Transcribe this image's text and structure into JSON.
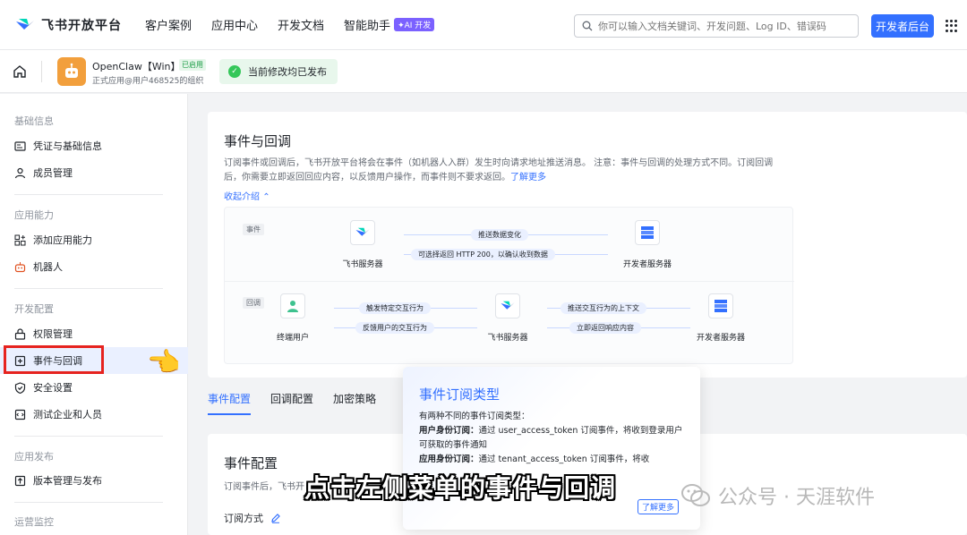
{
  "nav": {
    "brand": "飞书开放平台",
    "links": [
      "客户案例",
      "应用中心",
      "开发文档",
      "智能助手"
    ],
    "ai_badge": "✦AI 开发",
    "search_placeholder": "你可以输入文档关键词、开发问题、Log ID、错误码",
    "dev_console": "开发者后台"
  },
  "appbar": {
    "app_name": "OpenClaw【Win】",
    "online_tag": "已启用",
    "app_sub": "正式应用@用户468525的组织",
    "status": "当前修改均已发布"
  },
  "sidebar": {
    "groups": [
      "基础信息",
      "应用能力",
      "开发配置",
      "应用发布",
      "运营监控"
    ],
    "items": [
      "凭证与基础信息",
      "成员管理",
      "添加应用能力",
      "机器人",
      "权限管理",
      "事件与回调",
      "安全设置",
      "测试企业和人员",
      "版本管理与发布"
    ]
  },
  "card": {
    "title": "事件与回调",
    "desc": "订阅事件或回调后，飞书开放平台将会在事件（如机器人入群）发生时向请求地址推送消息。 注意：事件与回调的处理方式不同。订阅回调后，你需要立即返回回应内容，以反馈用户操作，而事件则不要求返回。",
    "desc_link": "了解更多",
    "collapse": "收起介绍"
  },
  "diagram": {
    "event_tag": "事件",
    "callback_tag": "回调",
    "feishu_server": "飞书服务器",
    "dev_server": "开发者服务器",
    "end_user": "终端用户",
    "push_change": "推送数据变化",
    "optional_return": "可选择返回 HTTP 200，以确认收到数据",
    "trigger": "触发特定交互行为",
    "feedback": "反馈用户的交互行为",
    "push_context": "推送交互行为的上下文",
    "return_now": "立即返回响应内容"
  },
  "tabs": [
    "事件配置",
    "回调配置",
    "加密策略"
  ],
  "event_config": {
    "title": "事件配置",
    "desc": "订阅事件后，飞书开",
    "mode": "订阅方式"
  },
  "popup": {
    "title": "事件订阅类型",
    "intro": "有两种不同的事件订阅类型：",
    "user_label": "用户身份订阅：",
    "user_text": "通过 user_access_token 订阅事件，将收到登录用户可获取的事件通知",
    "app_label": "应用身份订阅：",
    "app_text": "通过 tenant_access_token 订阅事件，将收",
    "more": "了解更多"
  },
  "overlay": {
    "subtitle": "点击左侧菜单的事件与回调",
    "watermark": "公众号 · 天涯软件"
  }
}
